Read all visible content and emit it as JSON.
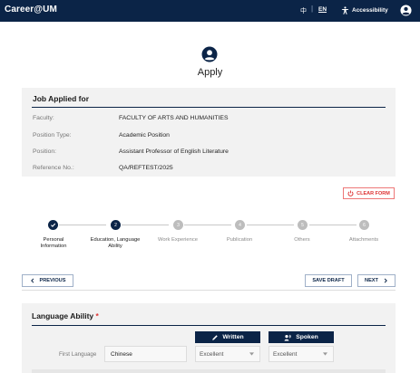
{
  "header": {
    "brand": "Career@UM",
    "lang_toggle": "中",
    "separator": "|",
    "lang": "EN",
    "accessibility_label": "Accessibility"
  },
  "page": {
    "title": "Apply"
  },
  "job": {
    "heading": "Job Applied for",
    "rows": [
      {
        "label": "Faculty:",
        "value": "FACULTY OF ARTS AND HUMANITIES"
      },
      {
        "label": "Position Type:",
        "value": "Academic Position"
      },
      {
        "label": "Position:",
        "value": "Assistant Professor of English Literature"
      },
      {
        "label": "Reference No.:",
        "value": "QA/REFTEST/2025"
      }
    ]
  },
  "actions": {
    "clear_form": "CLEAR FORM",
    "previous": "PREVIOUS",
    "save_draft": "SAVE DRAFT",
    "next": "NEXT"
  },
  "steps": [
    {
      "number": "1",
      "label_line1": "Personal",
      "label_line2": "Information",
      "state": "done"
    },
    {
      "number": "2",
      "label_line1": "Education, Language",
      "label_line2": "Ability",
      "state": "active"
    },
    {
      "number": "3",
      "label_line1": "Work Experience",
      "label_line2": "",
      "state": "todo"
    },
    {
      "number": "4",
      "label_line1": "Publication",
      "label_line2": "",
      "state": "todo"
    },
    {
      "number": "5",
      "label_line1": "Others",
      "label_line2": "",
      "state": "todo"
    },
    {
      "number": "6",
      "label_line1": "Attachments",
      "label_line2": "",
      "state": "todo"
    }
  ],
  "language": {
    "heading": "Language Ability",
    "required_mark": "*",
    "written_label": "Written",
    "spoken_label": "Spoken",
    "first_language_label": "First Language",
    "first_language_value": "Chinese",
    "written_value": "Excellent",
    "spoken_value": "Excellent"
  },
  "colors": {
    "navy": "#0b2447",
    "danger": "#d33333"
  }
}
